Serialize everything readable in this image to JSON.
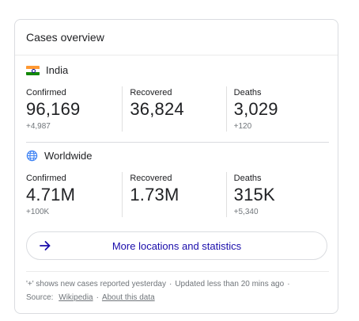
{
  "card": {
    "title": "Cases overview"
  },
  "regions": {
    "india": {
      "name": "India",
      "icon": "india-flag-icon",
      "flag_colors": [
        "#ff9933",
        "#ffffff",
        "#138808"
      ],
      "confirmed_label": "Confirmed",
      "confirmed_value": "96,169",
      "confirmed_delta": "+4,987",
      "recovered_label": "Recovered",
      "recovered_value": "36,824",
      "recovered_delta": "",
      "deaths_label": "Deaths",
      "deaths_value": "3,029",
      "deaths_delta": "+120"
    },
    "worldwide": {
      "name": "Worldwide",
      "icon": "globe-icon",
      "confirmed_label": "Confirmed",
      "confirmed_value": "4.71M",
      "confirmed_delta": "+100K",
      "recovered_label": "Recovered",
      "recovered_value": "1.73M",
      "recovered_delta": "",
      "deaths_label": "Deaths",
      "deaths_value": "315K",
      "deaths_delta": "+5,340"
    }
  },
  "more_button": {
    "label": "More locations and statistics",
    "icon": "arrow-right-icon",
    "color": "#1a0dab"
  },
  "footer": {
    "note": "'+' shows new cases reported yesterday",
    "updated": "Updated less than 20 mins ago",
    "source_label": "Source:",
    "source_link": "Wikipedia",
    "about_link": "About this data",
    "separator": "·"
  }
}
